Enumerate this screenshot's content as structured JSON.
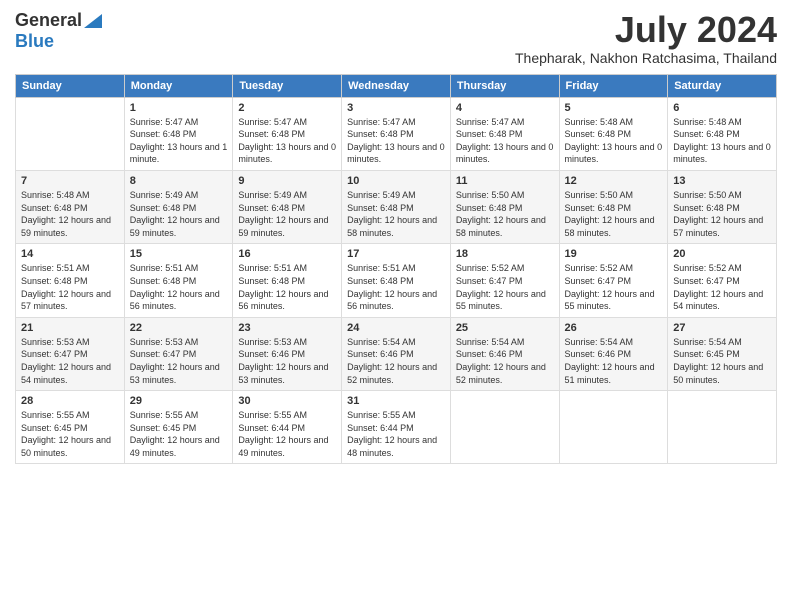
{
  "header": {
    "logo_general": "General",
    "logo_blue": "Blue",
    "month_title": "July 2024",
    "location": "Thepharak, Nakhon Ratchasima, Thailand"
  },
  "weekdays": [
    "Sunday",
    "Monday",
    "Tuesday",
    "Wednesday",
    "Thursday",
    "Friday",
    "Saturday"
  ],
  "weeks": [
    [
      {
        "day": "",
        "sunrise": "",
        "sunset": "",
        "daylight": ""
      },
      {
        "day": "1",
        "sunrise": "Sunrise: 5:47 AM",
        "sunset": "Sunset: 6:48 PM",
        "daylight": "Daylight: 13 hours and 1 minute."
      },
      {
        "day": "2",
        "sunrise": "Sunrise: 5:47 AM",
        "sunset": "Sunset: 6:48 PM",
        "daylight": "Daylight: 13 hours and 0 minutes."
      },
      {
        "day": "3",
        "sunrise": "Sunrise: 5:47 AM",
        "sunset": "Sunset: 6:48 PM",
        "daylight": "Daylight: 13 hours and 0 minutes."
      },
      {
        "day": "4",
        "sunrise": "Sunrise: 5:47 AM",
        "sunset": "Sunset: 6:48 PM",
        "daylight": "Daylight: 13 hours and 0 minutes."
      },
      {
        "day": "5",
        "sunrise": "Sunrise: 5:48 AM",
        "sunset": "Sunset: 6:48 PM",
        "daylight": "Daylight: 13 hours and 0 minutes."
      },
      {
        "day": "6",
        "sunrise": "Sunrise: 5:48 AM",
        "sunset": "Sunset: 6:48 PM",
        "daylight": "Daylight: 13 hours and 0 minutes."
      }
    ],
    [
      {
        "day": "7",
        "sunrise": "Sunrise: 5:48 AM",
        "sunset": "Sunset: 6:48 PM",
        "daylight": "Daylight: 12 hours and 59 minutes."
      },
      {
        "day": "8",
        "sunrise": "Sunrise: 5:49 AM",
        "sunset": "Sunset: 6:48 PM",
        "daylight": "Daylight: 12 hours and 59 minutes."
      },
      {
        "day": "9",
        "sunrise": "Sunrise: 5:49 AM",
        "sunset": "Sunset: 6:48 PM",
        "daylight": "Daylight: 12 hours and 59 minutes."
      },
      {
        "day": "10",
        "sunrise": "Sunrise: 5:49 AM",
        "sunset": "Sunset: 6:48 PM",
        "daylight": "Daylight: 12 hours and 58 minutes."
      },
      {
        "day": "11",
        "sunrise": "Sunrise: 5:50 AM",
        "sunset": "Sunset: 6:48 PM",
        "daylight": "Daylight: 12 hours and 58 minutes."
      },
      {
        "day": "12",
        "sunrise": "Sunrise: 5:50 AM",
        "sunset": "Sunset: 6:48 PM",
        "daylight": "Daylight: 12 hours and 58 minutes."
      },
      {
        "day": "13",
        "sunrise": "Sunrise: 5:50 AM",
        "sunset": "Sunset: 6:48 PM",
        "daylight": "Daylight: 12 hours and 57 minutes."
      }
    ],
    [
      {
        "day": "14",
        "sunrise": "Sunrise: 5:51 AM",
        "sunset": "Sunset: 6:48 PM",
        "daylight": "Daylight: 12 hours and 57 minutes."
      },
      {
        "day": "15",
        "sunrise": "Sunrise: 5:51 AM",
        "sunset": "Sunset: 6:48 PM",
        "daylight": "Daylight: 12 hours and 56 minutes."
      },
      {
        "day": "16",
        "sunrise": "Sunrise: 5:51 AM",
        "sunset": "Sunset: 6:48 PM",
        "daylight": "Daylight: 12 hours and 56 minutes."
      },
      {
        "day": "17",
        "sunrise": "Sunrise: 5:51 AM",
        "sunset": "Sunset: 6:48 PM",
        "daylight": "Daylight: 12 hours and 56 minutes."
      },
      {
        "day": "18",
        "sunrise": "Sunrise: 5:52 AM",
        "sunset": "Sunset: 6:47 PM",
        "daylight": "Daylight: 12 hours and 55 minutes."
      },
      {
        "day": "19",
        "sunrise": "Sunrise: 5:52 AM",
        "sunset": "Sunset: 6:47 PM",
        "daylight": "Daylight: 12 hours and 55 minutes."
      },
      {
        "day": "20",
        "sunrise": "Sunrise: 5:52 AM",
        "sunset": "Sunset: 6:47 PM",
        "daylight": "Daylight: 12 hours and 54 minutes."
      }
    ],
    [
      {
        "day": "21",
        "sunrise": "Sunrise: 5:53 AM",
        "sunset": "Sunset: 6:47 PM",
        "daylight": "Daylight: 12 hours and 54 minutes."
      },
      {
        "day": "22",
        "sunrise": "Sunrise: 5:53 AM",
        "sunset": "Sunset: 6:47 PM",
        "daylight": "Daylight: 12 hours and 53 minutes."
      },
      {
        "day": "23",
        "sunrise": "Sunrise: 5:53 AM",
        "sunset": "Sunset: 6:46 PM",
        "daylight": "Daylight: 12 hours and 53 minutes."
      },
      {
        "day": "24",
        "sunrise": "Sunrise: 5:54 AM",
        "sunset": "Sunset: 6:46 PM",
        "daylight": "Daylight: 12 hours and 52 minutes."
      },
      {
        "day": "25",
        "sunrise": "Sunrise: 5:54 AM",
        "sunset": "Sunset: 6:46 PM",
        "daylight": "Daylight: 12 hours and 52 minutes."
      },
      {
        "day": "26",
        "sunrise": "Sunrise: 5:54 AM",
        "sunset": "Sunset: 6:46 PM",
        "daylight": "Daylight: 12 hours and 51 minutes."
      },
      {
        "day": "27",
        "sunrise": "Sunrise: 5:54 AM",
        "sunset": "Sunset: 6:45 PM",
        "daylight": "Daylight: 12 hours and 50 minutes."
      }
    ],
    [
      {
        "day": "28",
        "sunrise": "Sunrise: 5:55 AM",
        "sunset": "Sunset: 6:45 PM",
        "daylight": "Daylight: 12 hours and 50 minutes."
      },
      {
        "day": "29",
        "sunrise": "Sunrise: 5:55 AM",
        "sunset": "Sunset: 6:45 PM",
        "daylight": "Daylight: 12 hours and 49 minutes."
      },
      {
        "day": "30",
        "sunrise": "Sunrise: 5:55 AM",
        "sunset": "Sunset: 6:44 PM",
        "daylight": "Daylight: 12 hours and 49 minutes."
      },
      {
        "day": "31",
        "sunrise": "Sunrise: 5:55 AM",
        "sunset": "Sunset: 6:44 PM",
        "daylight": "Daylight: 12 hours and 48 minutes."
      },
      {
        "day": "",
        "sunrise": "",
        "sunset": "",
        "daylight": ""
      },
      {
        "day": "",
        "sunrise": "",
        "sunset": "",
        "daylight": ""
      },
      {
        "day": "",
        "sunrise": "",
        "sunset": "",
        "daylight": ""
      }
    ]
  ]
}
